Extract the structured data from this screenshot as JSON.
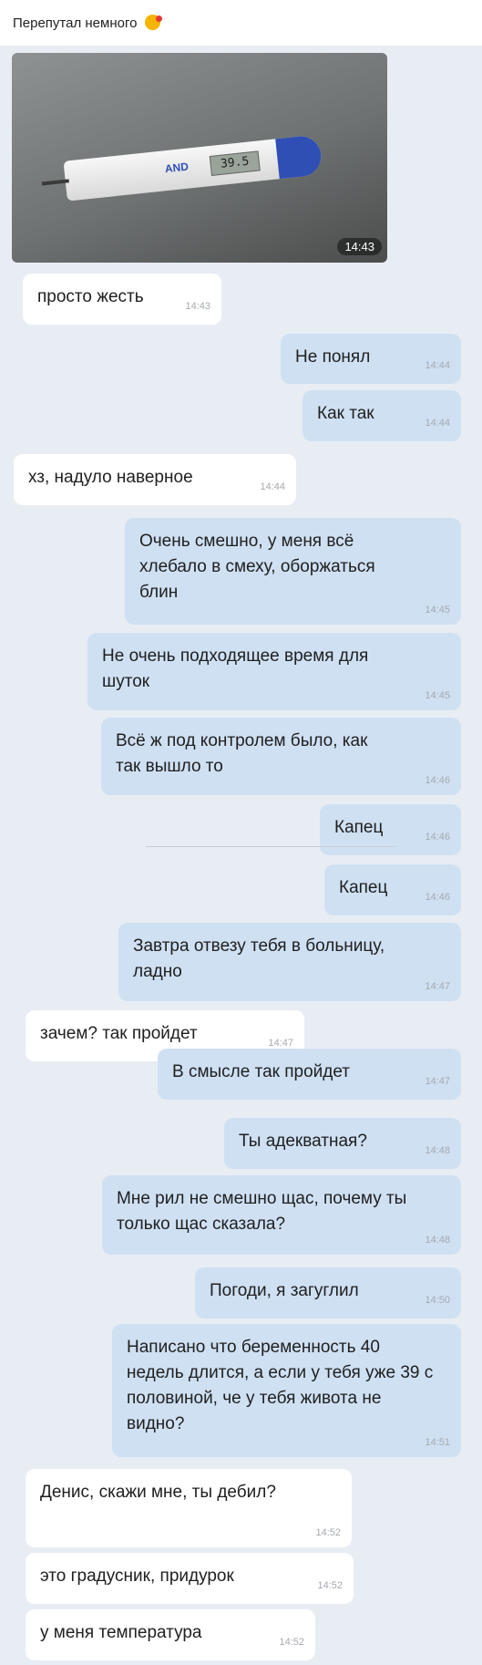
{
  "post": {
    "title": "Перепутал немного"
  },
  "photo": {
    "time": "14:43",
    "display": "39.5",
    "brand": "AND"
  },
  "messages": [
    {
      "text": "просто жесть",
      "time": "14:43"
    },
    {
      "text": "Не понял",
      "time": "14:44"
    },
    {
      "text": "Как так",
      "time": "14:44"
    },
    {
      "text": "хз, надуло наверное",
      "time": "14:44"
    },
    {
      "text": "Очень смешно, у меня всё хлебало в смеху, оборжаться блин",
      "time": "14:45"
    },
    {
      "text": "Не очень подходящее время для шуток",
      "time": "14:45"
    },
    {
      "text": "Всё ж под контролем было, как так вышло то",
      "time": "14:46"
    },
    {
      "text": "Капец",
      "time": "14:46"
    },
    {
      "text": "Капец",
      "time": "14:46"
    },
    {
      "text": "Завтра отвезу тебя в больницу, ладно",
      "time": "14:47"
    },
    {
      "text": "зачем? так пройдет",
      "time": "14:47"
    },
    {
      "text": "В смысле так пройдет",
      "time": "14:47"
    },
    {
      "text": "Ты адекватная?",
      "time": "14:48"
    },
    {
      "text": "Мне рил не смешно щас, почему ты только щас сказала?",
      "time": "14:48"
    },
    {
      "text": "Погоди, я загуглил",
      "time": "14:50"
    },
    {
      "text": "Написано что беременность 40 недель длится, а если у тебя уже 39 с половиной, че у тебя живота не видно?",
      "time": "14:51"
    },
    {
      "text": "Денис, скажи мне, ты дебил?",
      "time": "14:52"
    },
    {
      "text": "это градусник, придурок",
      "time": "14:52"
    },
    {
      "text": "у меня температура",
      "time": "14:52"
    }
  ]
}
